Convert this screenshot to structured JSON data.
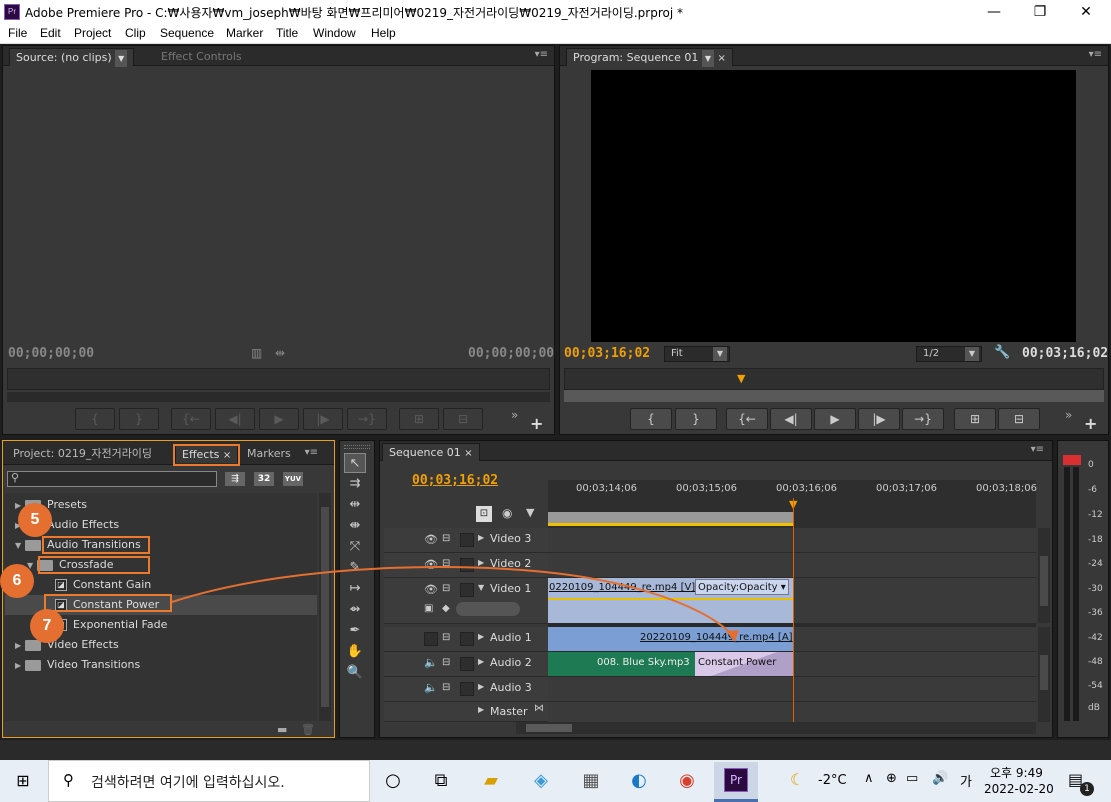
{
  "window": {
    "icon": "Pr",
    "title": "Adobe Premiere Pro - C:₩사용자₩vm_joseph₩바탕 화면₩프리미어₩0219_자전거라이딩₩0219_자전거라이딩.prproj *",
    "minimize": "—",
    "maximize": "❐",
    "close": "✕"
  },
  "menu": [
    "File",
    "Edit",
    "Project",
    "Clip",
    "Sequence",
    "Marker",
    "Title",
    "Window",
    "Help"
  ],
  "source_panel": {
    "tab_source": "Source: (no clips)",
    "tab_effect_controls": "Effect Controls",
    "tc_left": "00;00;00;00",
    "tc_right": "00;00;00;00"
  },
  "program_panel": {
    "tab": "Program: Sequence 01",
    "tc_left": "00;03;16;02",
    "fit": "Fit",
    "res": "1/2",
    "tc_right": "00;03;16;02"
  },
  "transport_icons": [
    "{",
    "}",
    "{←",
    "◀|",
    "▶",
    "|▶",
    "→}"
  ],
  "project_panel": {
    "tab_project": "Project: 0219_자전거라이딩",
    "tab_effects": "Effects",
    "tab_markers": "Markers",
    "btn_32": "32",
    "btn_yuv": "YUV",
    "tree": [
      {
        "label": "Presets",
        "type": "folder"
      },
      {
        "label": "Audio Effects",
        "type": "folder"
      },
      {
        "label": "Audio Transitions",
        "type": "folder"
      },
      {
        "label": "Crossfade",
        "type": "folder"
      },
      {
        "label": "Constant Gain",
        "type": "fx"
      },
      {
        "label": "Constant Power",
        "type": "fx"
      },
      {
        "label": "Exponential Fade",
        "type": "fx"
      },
      {
        "label": "Video Effects",
        "type": "folder"
      },
      {
        "label": "Video Transitions",
        "type": "folder"
      }
    ]
  },
  "callouts": [
    "5",
    "6",
    "7"
  ],
  "timeline": {
    "tab": "Sequence 01",
    "tc": "00;03;16;02",
    "ruler": [
      "00;03;14;06",
      "00;03;15;06",
      "00;03;16;06",
      "00;03;17;06",
      "00;03;18;06"
    ],
    "tracks": [
      "Video 3",
      "Video 2",
      "Video 1",
      "Audio 1",
      "Audio 2",
      "Audio 3",
      "Master"
    ],
    "clip_v1": "0220109_104449_re.mp4 [V]",
    "clip_v1_opacity": "Opacity:Opacity ▾",
    "clip_a1": "20220109_104449_re.mp4 [A]",
    "clip_a2": "008. Blue Sky.mp3",
    "transition_a2": "Constant Power"
  },
  "meter": {
    "labels": [
      "0",
      "-6",
      "-12",
      "-18",
      "-24",
      "-30",
      "-36",
      "-42",
      "-48",
      "-54",
      "dB"
    ]
  },
  "taskbar": {
    "search_placeholder": "검색하려면 여기에 입력하십시오.",
    "weather": "-2°C",
    "lang": "가",
    "time": "오후 9:49",
    "date": "2022-02-20",
    "notif_count": "1"
  }
}
